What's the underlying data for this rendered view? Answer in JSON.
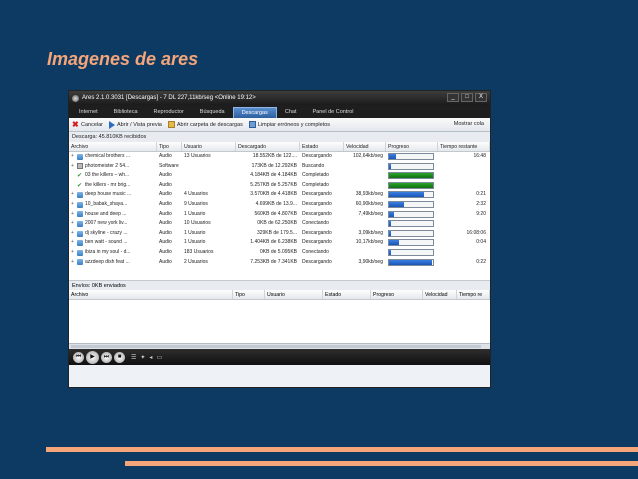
{
  "slide": {
    "title": "Imagenes de ares"
  },
  "window": {
    "title": "Ares 2.1.0.3031  [Descargas]  -  7 DL 227,11kb/seg   <Online 19:12>",
    "controls": [
      "_",
      "□",
      "X"
    ]
  },
  "tabs": [
    "Internet",
    "Biblioteca",
    "Reproductor",
    "Búsqueda",
    "Descargas",
    "Chat",
    "Panel de Control"
  ],
  "active_tab": "Descargas",
  "toolbar": {
    "cancel": "Cancelar",
    "preview": "Abrir / Vista previa",
    "open_folder": "Abrir carpeta de descargas",
    "clean": "Limpiar erróneos y completos",
    "show_queue": "Mostrar cola"
  },
  "downloads": {
    "header": "Descarga: 45.810KB recibidos",
    "columns": [
      "Archivo",
      "Tipo",
      "Usuario",
      "Descargado",
      "Estado",
      "Velocidad",
      "Progreso",
      "Tiempo restante"
    ],
    "rows": [
      {
        "file": "chemical brothers ...",
        "type": "Audio",
        "user": "13 Usuarios",
        "downloaded": "18.552KB de 122....",
        "status": "Descargando",
        "speed": "102,64kb/seg",
        "progress": 0.15,
        "complete": false,
        "time": "16:48",
        "icon": "audio"
      },
      {
        "file": "photomeister 2 54...",
        "type": "Software",
        "user": "",
        "downloaded": "173KB de 12.292KB",
        "status": "Buscando",
        "speed": "",
        "progress": 0,
        "complete": false,
        "time": "",
        "icon": "soft"
      },
      {
        "file": "03 the killers – wh...",
        "type": "Audio",
        "user": "",
        "downloaded": "4.184KB de 4.184KB",
        "status": "Completado",
        "speed": "",
        "progress": 1,
        "complete": true,
        "time": "",
        "icon": "done"
      },
      {
        "file": "the killers - mr brig...",
        "type": "Audio",
        "user": "",
        "downloaded": "5.257KB de 5.257KB",
        "status": "Completado",
        "speed": "",
        "progress": 1,
        "complete": true,
        "time": "",
        "icon": "done"
      },
      {
        "file": "deep house music ...",
        "type": "Audio",
        "user": "4 Usuarios",
        "downloaded": "3.570KB de 4.418KB",
        "status": "Descargando",
        "speed": "38,93kb/seg",
        "progress": 0.8,
        "complete": false,
        "time": "0:21",
        "icon": "audio"
      },
      {
        "file": "10_babak_shaya...",
        "type": "Audio",
        "user": "9 Usuarios",
        "downloaded": "4.699KB de 13.9...",
        "status": "Descargando",
        "speed": "60,90kb/seg",
        "progress": 0.33,
        "complete": false,
        "time": "2:32",
        "icon": "audio"
      },
      {
        "file": "house and deep ...",
        "type": "Audio",
        "user": "1 Usuario",
        "downloaded": "560KB de 4.807KB",
        "status": "Descargando",
        "speed": "7,49kb/seg",
        "progress": 0.12,
        "complete": false,
        "time": "9:20",
        "icon": "audio"
      },
      {
        "file": "2007 new york liv...",
        "type": "Audio",
        "user": "10 Usuarios",
        "downloaded": "0KB de 62.250KB",
        "status": "Conectando",
        "speed": "",
        "progress": 0,
        "complete": false,
        "time": "",
        "icon": "audio"
      },
      {
        "file": "dj skyline - crazy ...",
        "type": "Audio",
        "user": "1 Usuario",
        "downloaded": "329KB de 179.5...",
        "status": "Descargando",
        "speed": "3,09kb/seg",
        "progress": 0.02,
        "complete": false,
        "time": "16:08:06",
        "icon": "audio"
      },
      {
        "file": "ben watt - sound ...",
        "type": "Audio",
        "user": "1 Usuario",
        "downloaded": "1.404KB de 6.238KB",
        "status": "Descargando",
        "speed": "10,17kb/seg",
        "progress": 0.22,
        "complete": false,
        "time": "0:04",
        "icon": "audio"
      },
      {
        "file": "ibiza in my soul - d...",
        "type": "Audio",
        "user": "183 Usuarios",
        "downloaded": "0KB de 5.095KB",
        "status": "Conectando",
        "speed": "",
        "progress": 0,
        "complete": false,
        "time": "",
        "icon": "audio"
      },
      {
        "file": "azzdeep dish feat ...",
        "type": "Audio",
        "user": "2 Usuarios",
        "downloaded": "7.253KB de 7.341KB",
        "status": "Descargando",
        "speed": "3,90kb/seg",
        "progress": 0.98,
        "complete": false,
        "time": "0:22",
        "icon": "audio"
      }
    ]
  },
  "uploads": {
    "header": "Envíos: 0KB enviados",
    "columns": [
      "Archivo",
      "Tipo",
      "Usuario",
      "Estado",
      "Progreso",
      "Velocidad",
      "Tiempo re"
    ]
  },
  "player": {
    "buttons": [
      "prev",
      "play",
      "next",
      "stop"
    ]
  },
  "colors": {
    "background": "#0d3a63",
    "accent": "#f4a57a",
    "progress_blue": "#1b55b8",
    "progress_green": "#136e13"
  }
}
